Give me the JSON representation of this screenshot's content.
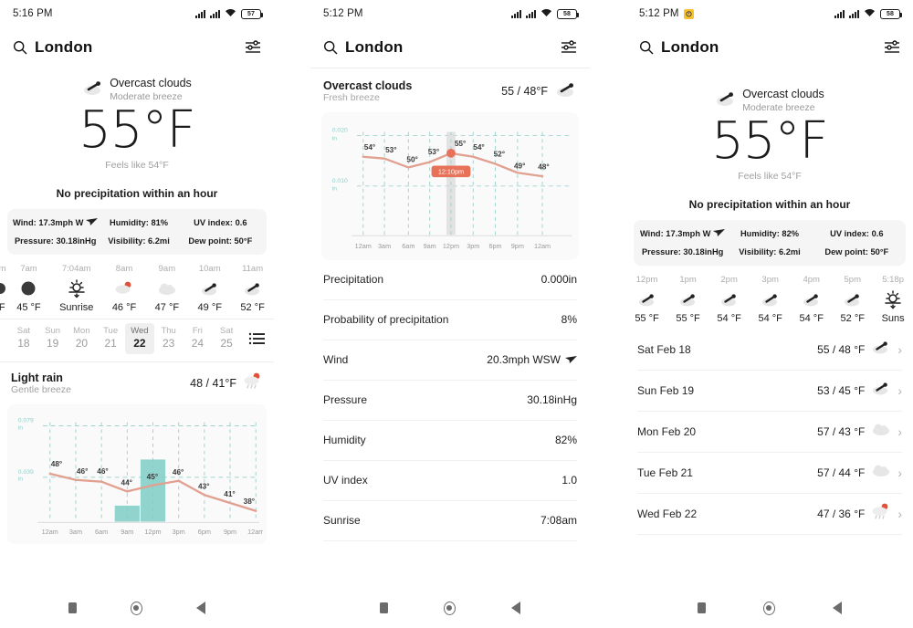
{
  "panels": [
    {
      "id": "panel-current",
      "status": {
        "time": "5:16 PM",
        "alarm": false,
        "battery": "57"
      },
      "appbar": {
        "city": "London",
        "search_icon": "search-icon",
        "settings_icon": "sliders-icon"
      },
      "current": {
        "condition": "Overcast clouds",
        "wind_desc": "Moderate breeze",
        "temp": "55°F",
        "feels_like": "Feels like 54°F",
        "icon": "cloud-wind-icon"
      },
      "precip_note": "No precipitation within an hour",
      "details": [
        {
          "label": "Wind: 17.3mph W",
          "icon": "wind-arrow-icon"
        },
        {
          "label": "Humidity: 81%",
          "icon": ""
        },
        {
          "label": "UV index: 0.6",
          "icon": ""
        },
        {
          "label": "Pressure: 30.18inHg",
          "icon": ""
        },
        {
          "label": "Visibility: 6.2mi",
          "icon": ""
        },
        {
          "label": "Dew point: 50°F",
          "icon": ""
        }
      ],
      "hourly": [
        {
          "time": "am",
          "icon": "moon-icon",
          "temp": "°F"
        },
        {
          "time": "7am",
          "icon": "moon-icon",
          "temp": "45 °F"
        },
        {
          "time": "7:04am",
          "icon": "sunrise-icon",
          "temp": "Sunrise"
        },
        {
          "time": "8am",
          "icon": "rain-sun-icon",
          "temp": "46 °F"
        },
        {
          "time": "9am",
          "icon": "cloud-icon",
          "temp": "47 °F"
        },
        {
          "time": "10am",
          "icon": "cloud-wind-icon",
          "temp": "49 °F"
        },
        {
          "time": "11am",
          "icon": "cloud-wind-icon",
          "temp": "52 °F"
        }
      ],
      "days": [
        {
          "name": "Sat",
          "num": "18",
          "selected": false
        },
        {
          "name": "Sun",
          "num": "19",
          "selected": false
        },
        {
          "name": "Mon",
          "num": "20",
          "selected": false
        },
        {
          "name": "Tue",
          "num": "21",
          "selected": false
        },
        {
          "name": "Wed",
          "num": "22",
          "selected": true
        },
        {
          "name": "Thu",
          "num": "23",
          "selected": false
        },
        {
          "name": "Fri",
          "num": "24",
          "selected": false
        },
        {
          "name": "Sat",
          "num": "25",
          "selected": false
        }
      ],
      "list_icon": "list-view-icon",
      "day_summary": {
        "condition": "Light rain",
        "wind_desc": "Gentle breeze",
        "temp": "48 / 41°F",
        "icon": "rain-sun-icon"
      }
    },
    {
      "id": "panel-detail",
      "status": {
        "time": "5:12 PM",
        "alarm": false,
        "battery": "58"
      },
      "appbar": {
        "city": "London",
        "search_icon": "search-icon",
        "settings_icon": "sliders-icon"
      },
      "summary": {
        "condition": "Overcast clouds",
        "wind_desc": "Fresh breeze",
        "temp": "55 / 48°F",
        "icon": "cloud-wind-icon"
      },
      "detail_rows": [
        {
          "label": "Precipitation",
          "value": "0.000in",
          "icon": ""
        },
        {
          "label": "Probability of precipitation",
          "value": "8%",
          "icon": ""
        },
        {
          "label": "Wind",
          "value": "20.3mph WSW",
          "icon": "wind-arrow-icon"
        },
        {
          "label": "Pressure",
          "value": "30.18inHg",
          "icon": ""
        },
        {
          "label": "Humidity",
          "value": "82%",
          "icon": ""
        },
        {
          "label": "UV index",
          "value": "1.0",
          "icon": ""
        },
        {
          "label": "Sunrise",
          "value": "7:08am",
          "icon": ""
        }
      ]
    },
    {
      "id": "panel-forecast",
      "status": {
        "time": "5:12 PM",
        "alarm": true,
        "battery": "58"
      },
      "appbar": {
        "city": "London",
        "search_icon": "search-icon",
        "settings_icon": "sliders-icon"
      },
      "current": {
        "condition": "Overcast clouds",
        "wind_desc": "Moderate breeze",
        "temp": "55°F",
        "feels_like": "Feels like 54°F",
        "icon": "cloud-wind-icon"
      },
      "precip_note": "No precipitation within an hour",
      "details": [
        {
          "label": "Wind: 17.3mph W",
          "icon": "wind-arrow-icon"
        },
        {
          "label": "Humidity: 82%",
          "icon": ""
        },
        {
          "label": "UV index: 0.6",
          "icon": ""
        },
        {
          "label": "Pressure: 30.18inHg",
          "icon": ""
        },
        {
          "label": "Visibility: 6.2mi",
          "icon": ""
        },
        {
          "label": "Dew point: 50°F",
          "icon": ""
        }
      ],
      "hourly": [
        {
          "time": "12pm",
          "icon": "cloud-wind-icon",
          "temp": "55 °F"
        },
        {
          "time": "1pm",
          "icon": "cloud-wind-icon",
          "temp": "55 °F"
        },
        {
          "time": "2pm",
          "icon": "cloud-wind-icon",
          "temp": "54 °F"
        },
        {
          "time": "3pm",
          "icon": "cloud-wind-icon",
          "temp": "54 °F"
        },
        {
          "time": "4pm",
          "icon": "cloud-wind-icon",
          "temp": "54 °F"
        },
        {
          "time": "5pm",
          "icon": "cloud-wind-icon",
          "temp": "52 °F"
        },
        {
          "time": "5:18p",
          "icon": "sunset-icon",
          "temp": "Suns"
        }
      ],
      "daily": [
        {
          "day": "Sat Feb 18",
          "temp": "55 / 48 °F",
          "icon": "cloud-wind-icon"
        },
        {
          "day": "Sun Feb 19",
          "temp": "53 / 45 °F",
          "icon": "cloud-wind-icon"
        },
        {
          "day": "Mon Feb 20",
          "temp": "57 / 43 °F",
          "icon": "cloud-icon"
        },
        {
          "day": "Tue Feb 21",
          "temp": "57 / 44 °F",
          "icon": "cloud-icon"
        },
        {
          "day": "Wed Feb 22",
          "temp": "47 / 36 °F",
          "icon": "rain-sun-icon"
        }
      ]
    }
  ],
  "colors": {
    "line": "#e2a091",
    "bar": "#7ecdc5",
    "axis_label": "#8fcfc8",
    "grid": "#9fd4ce",
    "card_bg": "#fafafa",
    "accent_dot": "#e8715a",
    "alarm": "#f7c22a"
  },
  "chart_data": [
    {
      "id": "chart-wed-22",
      "type": "line",
      "title": "",
      "xlabel": "",
      "ylabel": "in",
      "x": [
        "12am",
        "3am",
        "6am",
        "9am",
        "12pm",
        "3pm",
        "6pm",
        "9pm",
        "12am"
      ],
      "tick_labels": [
        "12am",
        "3am",
        "6am",
        "9am",
        "12pm",
        "3pm",
        "6pm",
        "9pm",
        "12am"
      ],
      "y_ticks": [
        "0.079",
        "0.039"
      ],
      "y_tick_unit": "in",
      "series": [
        {
          "name": "Temperature",
          "type": "line",
          "point_labels": [
            "48°",
            "46°",
            "46°",
            "44°",
            "45°",
            "46°",
            "43°",
            "41°",
            "38°"
          ],
          "values": [
            48,
            46,
            46,
            44,
            45,
            46,
            43,
            41,
            38
          ]
        },
        {
          "name": "Precipitation",
          "type": "bar",
          "values": [
            0,
            0,
            0,
            0.018,
            0.062,
            0,
            0,
            0,
            0
          ]
        }
      ],
      "grid": true,
      "legend": "none"
    },
    {
      "id": "chart-today-detail",
      "type": "line",
      "title": "",
      "xlabel": "",
      "ylabel": "in",
      "x": [
        "12am",
        "3am",
        "6am",
        "9am",
        "12pm",
        "3pm",
        "6pm",
        "9pm",
        "12am"
      ],
      "tick_labels": [
        "12am",
        "3am",
        "6am",
        "9am",
        "12pm",
        "3pm",
        "6pm",
        "9pm",
        "12am"
      ],
      "y_ticks": [
        "0.020",
        "0.010"
      ],
      "y_tick_unit": "in",
      "series": [
        {
          "name": "Temperature",
          "type": "line",
          "point_labels": [
            "54°",
            "53°",
            "50°",
            "53°",
            "55°",
            "54°",
            "52°",
            "49°",
            "48°"
          ],
          "values": [
            54,
            53,
            50,
            53,
            55,
            54,
            52,
            49,
            48
          ]
        }
      ],
      "marker": {
        "x": "12pm",
        "label": "12:10pm",
        "value": "55°"
      },
      "grid": true,
      "legend": "none"
    }
  ],
  "navbar": {
    "recent": "recents-button",
    "home": "home-button",
    "back": "back-button"
  }
}
